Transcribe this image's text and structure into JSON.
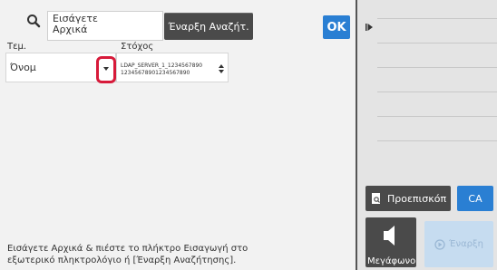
{
  "search": {
    "value": "Εισάγετε\nΑρχικά",
    "start_button": "Έναρξη Αναζήτ.",
    "ok_button": "OK"
  },
  "filters": {
    "item_label": "Τεμ.",
    "item_value": "Όνομ",
    "target_label": "Στόχος",
    "target_value_line1": "LDAP_SERVER_1_1234567890",
    "target_value_line2": "12345678901234567890"
  },
  "message": "Εισάγετε Αρχικά & πιέστε το πλήκτρο Εισαγωγή στο εξωτερικό πληκτρολόγιο ή [Έναρξη Αναζήτησης].",
  "right_panel": {
    "preview_button": "Προεπισκόπ",
    "ca_button": "CA",
    "speaker_button": "Μεγάφωνο",
    "send_button": "Έναρξη"
  },
  "colors": {
    "accent": "#2a7fd3",
    "highlight": "#d71a3a",
    "dark_button": "#4a4a4a"
  },
  "icons": [
    "search-icon",
    "chevron-down-icon",
    "updown-arrows-icon",
    "collapse-arrow-icon",
    "preview-icon",
    "speaker-icon",
    "start-icon"
  ]
}
